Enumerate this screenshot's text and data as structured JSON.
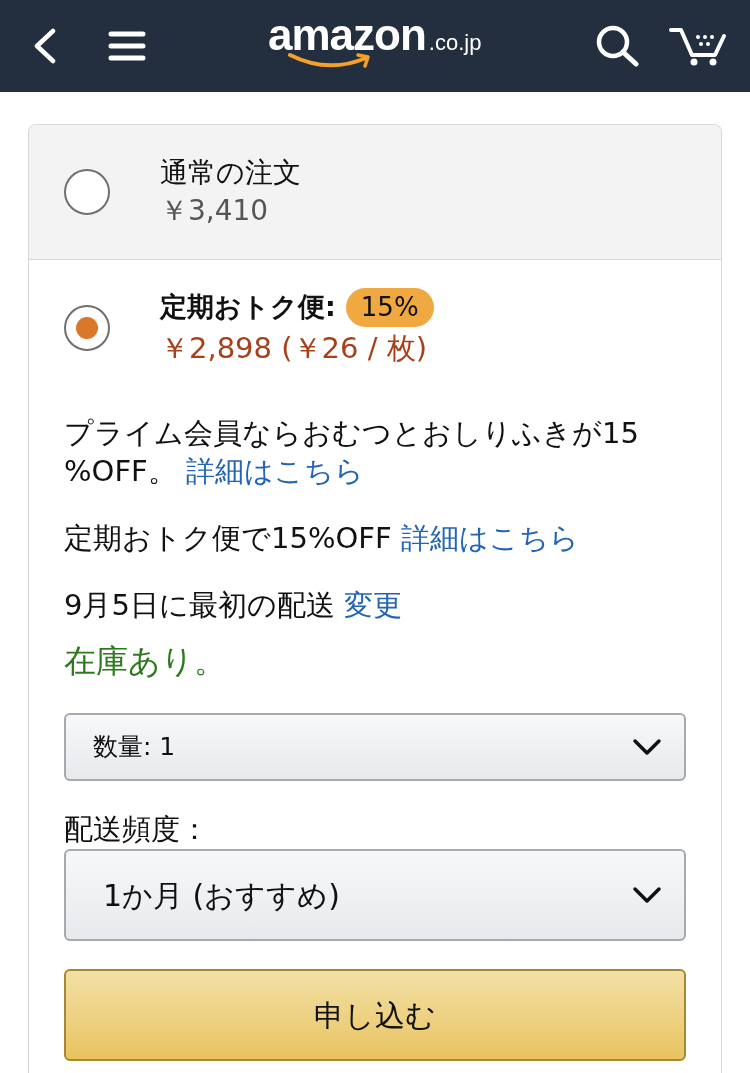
{
  "header": {
    "logo": {
      "wordmark": "amazon",
      "domain": ".co.jp"
    }
  },
  "purchase_options": [
    {
      "title": "通常の注文",
      "price": "￥3,410",
      "selected": false
    },
    {
      "title": "定期おトク便:",
      "badge": "15%",
      "price": "￥2,898 (￥26 / 枚)",
      "selected": true
    }
  ],
  "subscription": {
    "notes": [
      {
        "text": "プライム会員ならおむつとおしりふきが15%OFF。",
        "link": "詳細はこちら"
      },
      {
        "text": "定期おトク便で15%OFF",
        "link": "詳細はこちら"
      },
      {
        "text": "9月5日に最初の配送",
        "link": "変更"
      }
    ],
    "availability": "在庫あり。",
    "quantity_select": {
      "value": "数量: 1"
    },
    "frequency": {
      "label": "配送頻度：",
      "value": "1か月 (おすすめ)"
    },
    "submit_button": "申し込む"
  }
}
